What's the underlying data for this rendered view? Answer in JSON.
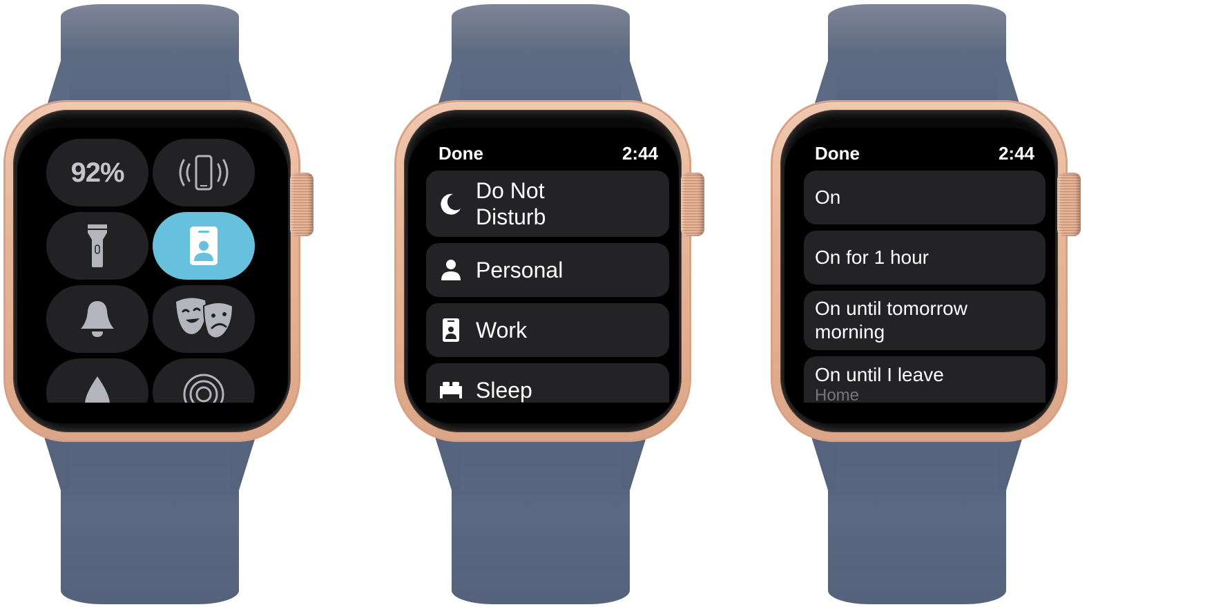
{
  "watches": [
    {
      "screen": "control-center",
      "tiles": [
        {
          "id": "battery",
          "label": "92%",
          "icon": "battery-percentage",
          "active": false
        },
        {
          "id": "ping-iphone",
          "icon": "ping-iphone-icon",
          "active": false
        },
        {
          "id": "flashlight",
          "icon": "flashlight-icon",
          "active": false
        },
        {
          "id": "focus-work",
          "icon": "work-focus-badge-icon",
          "active": true
        },
        {
          "id": "silent-mode",
          "icon": "bell-icon",
          "active": false
        },
        {
          "id": "theater-mode",
          "icon": "theater-masks-icon",
          "active": false
        },
        {
          "id": "water-lock",
          "icon": "water-drop-icon",
          "active": false
        },
        {
          "id": "airplay",
          "icon": "airplay-audio-icon",
          "active": false
        }
      ],
      "active_color": "#68c1dc"
    },
    {
      "screen": "focus-list",
      "header": {
        "done_label": "Done",
        "time": "2:44"
      },
      "items": [
        {
          "label": "Do Not Disturb",
          "label_lines": [
            "Do Not",
            "Disturb"
          ],
          "icon": "moon-icon"
        },
        {
          "label": "Personal",
          "icon": "person-icon"
        },
        {
          "label": "Work",
          "icon": "id-badge-icon"
        },
        {
          "label": "Sleep",
          "icon": "bed-icon"
        }
      ]
    },
    {
      "screen": "focus-duration",
      "header": {
        "done_label": "Done",
        "time": "2:44"
      },
      "options": [
        {
          "label": "On"
        },
        {
          "label": "On for 1 hour"
        },
        {
          "label": "On until tomorrow morning",
          "label_lines": [
            "On until tomorrow",
            "morning"
          ]
        },
        {
          "label": "On until I leave",
          "sublabel": "Home"
        }
      ]
    }
  ],
  "colors": {
    "band": "#5b6883",
    "case": "#e6b597",
    "tile_bg": "#222224",
    "row_bg": "#232325",
    "icon_gray": "#b4b5bc"
  }
}
